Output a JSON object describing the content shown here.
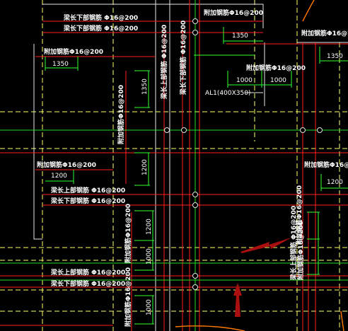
{
  "drawing": {
    "colors": {
      "background": "#000000",
      "beam_edge_yellow": "#ffff33",
      "axis_green": "#22dd22",
      "rebar_red": "#ff2020",
      "dim_green": "#33ff33",
      "text_white": "#ffffff",
      "arrow_red": "#aa1010",
      "orange_curve": "#ff7a00"
    },
    "labels": {
      "top_rebar_1": "附加钢筋Φ16@200",
      "beam_bottom_rebar_1": "梁长下部钢筋 Φ16@200",
      "left_rebar_1": "附加钢筋Φ16@200",
      "right_top_rebar": "附加钢筋Φ16@200",
      "mid_rebar": "附加钢筋Φ16@200",
      "left_rebar_2": "附加钢筋Φ16@200",
      "right_rebar_2": "附加钢筋Φ16@200",
      "beam_top_rebar_2": "梁长上部钢筋 Φ16@200",
      "beam_bottom_rebar_2": "梁长下部钢筋 Φ16@200",
      "beam_top_rebar_3": "梁长上部钢筋 Φ16@200",
      "beam_bottom_rebar_3": "梁长下部钢筋 Φ16@200",
      "vert_rebar_1": "附加钢筋Φ16@200",
      "vert_rebar_2": "梁长上部钢筋 Φ16@200",
      "vert_rebar_3": "梁长下部钢筋 Φ16@200",
      "vert_rebar_4": "附加钢筋Φ16@200",
      "vert_rebar_5": "附加钢筋Φ16@200",
      "vert_rebar_6": "附加钢筋Φ16@200",
      "vert_rebar_7": "梁长上部钢筋 Φ16@200",
      "vert_rebar_8": "附加钢筋Φ16@200",
      "beam_tag": "AL1(400X350)"
    },
    "dimensions": {
      "d1": "1350",
      "d2": "1350",
      "d3": "1350",
      "d4": "1000",
      "d5": "1000",
      "d6": "1350",
      "d7": "1200",
      "d8": "1200",
      "d9": "1200",
      "d10": "1000",
      "d11": "1000",
      "d12": "1200"
    }
  }
}
